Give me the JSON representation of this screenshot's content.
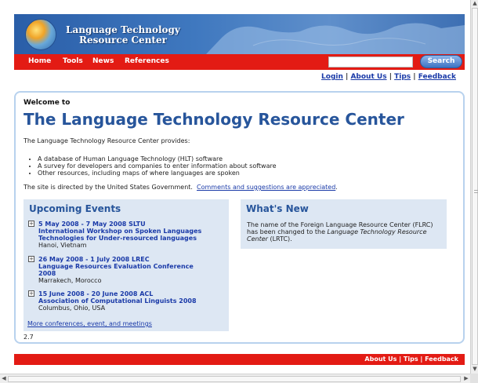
{
  "header": {
    "title_line1": "Language Technology",
    "title_line2": "Resource Center"
  },
  "nav": {
    "items": [
      "Home",
      "Tools",
      "News",
      "References"
    ],
    "search_value": "",
    "search_button": "Search"
  },
  "toplinks": {
    "login": "Login",
    "about": "About Us",
    "tips": "Tips",
    "feedback": "Feedback",
    "separator": " | "
  },
  "main": {
    "welcome": "Welcome to",
    "title": "The Language Technology Resource Center",
    "intro": "The Language Technology Resource Center provides:",
    "bullets": [
      "A database of Human Language Technology (HLT) software",
      "A survey for developers and companies to enter information about software",
      "Other resources, including maps of where languages are spoken"
    ],
    "directed_text": "The site is directed by the United States Government.",
    "directed_link": "Comments and suggestions are appreciated",
    "directed_end": ".",
    "version": "2.7"
  },
  "events": {
    "heading": "Upcoming Events",
    "items": [
      {
        "dates": "5 May 2008 - 7 May 2008   SLTU",
        "name": "International Workshop on Spoken Languages Technologies for Under-resourced languages",
        "place": "Hanoi, Vietnam"
      },
      {
        "dates": "26 May 2008 - 1 July 2008   LREC",
        "name": "Language Resources Evaluation Conference 2008",
        "place": "Marrakech, Morocco"
      },
      {
        "dates": "15 June 2008 - 20 June 2008   ACL",
        "name": "Association of Computational Linguists 2008",
        "place": "Columbus, Ohio, USA"
      }
    ],
    "more": "More conferences, event, and meetings"
  },
  "whats_new": {
    "heading": "What's New",
    "text_before": "The name of the Foreign Language Resource Center (FLRC) has been changed to the ",
    "text_italic": "Language Technology Resource Center",
    "text_after": " (LRTC)."
  },
  "footer": {
    "about": "About Us",
    "tips": "Tips",
    "feedback": "Feedback"
  },
  "icons": {
    "expand": "+",
    "scroll_up": "▲",
    "scroll_down": "▼",
    "scroll_left": "◀",
    "scroll_right": "▶"
  },
  "colors": {
    "brand_red": "#e31b14",
    "title_blue": "#27559b",
    "link_blue": "#1a3aa8",
    "panel_bg": "#dde7f3"
  }
}
